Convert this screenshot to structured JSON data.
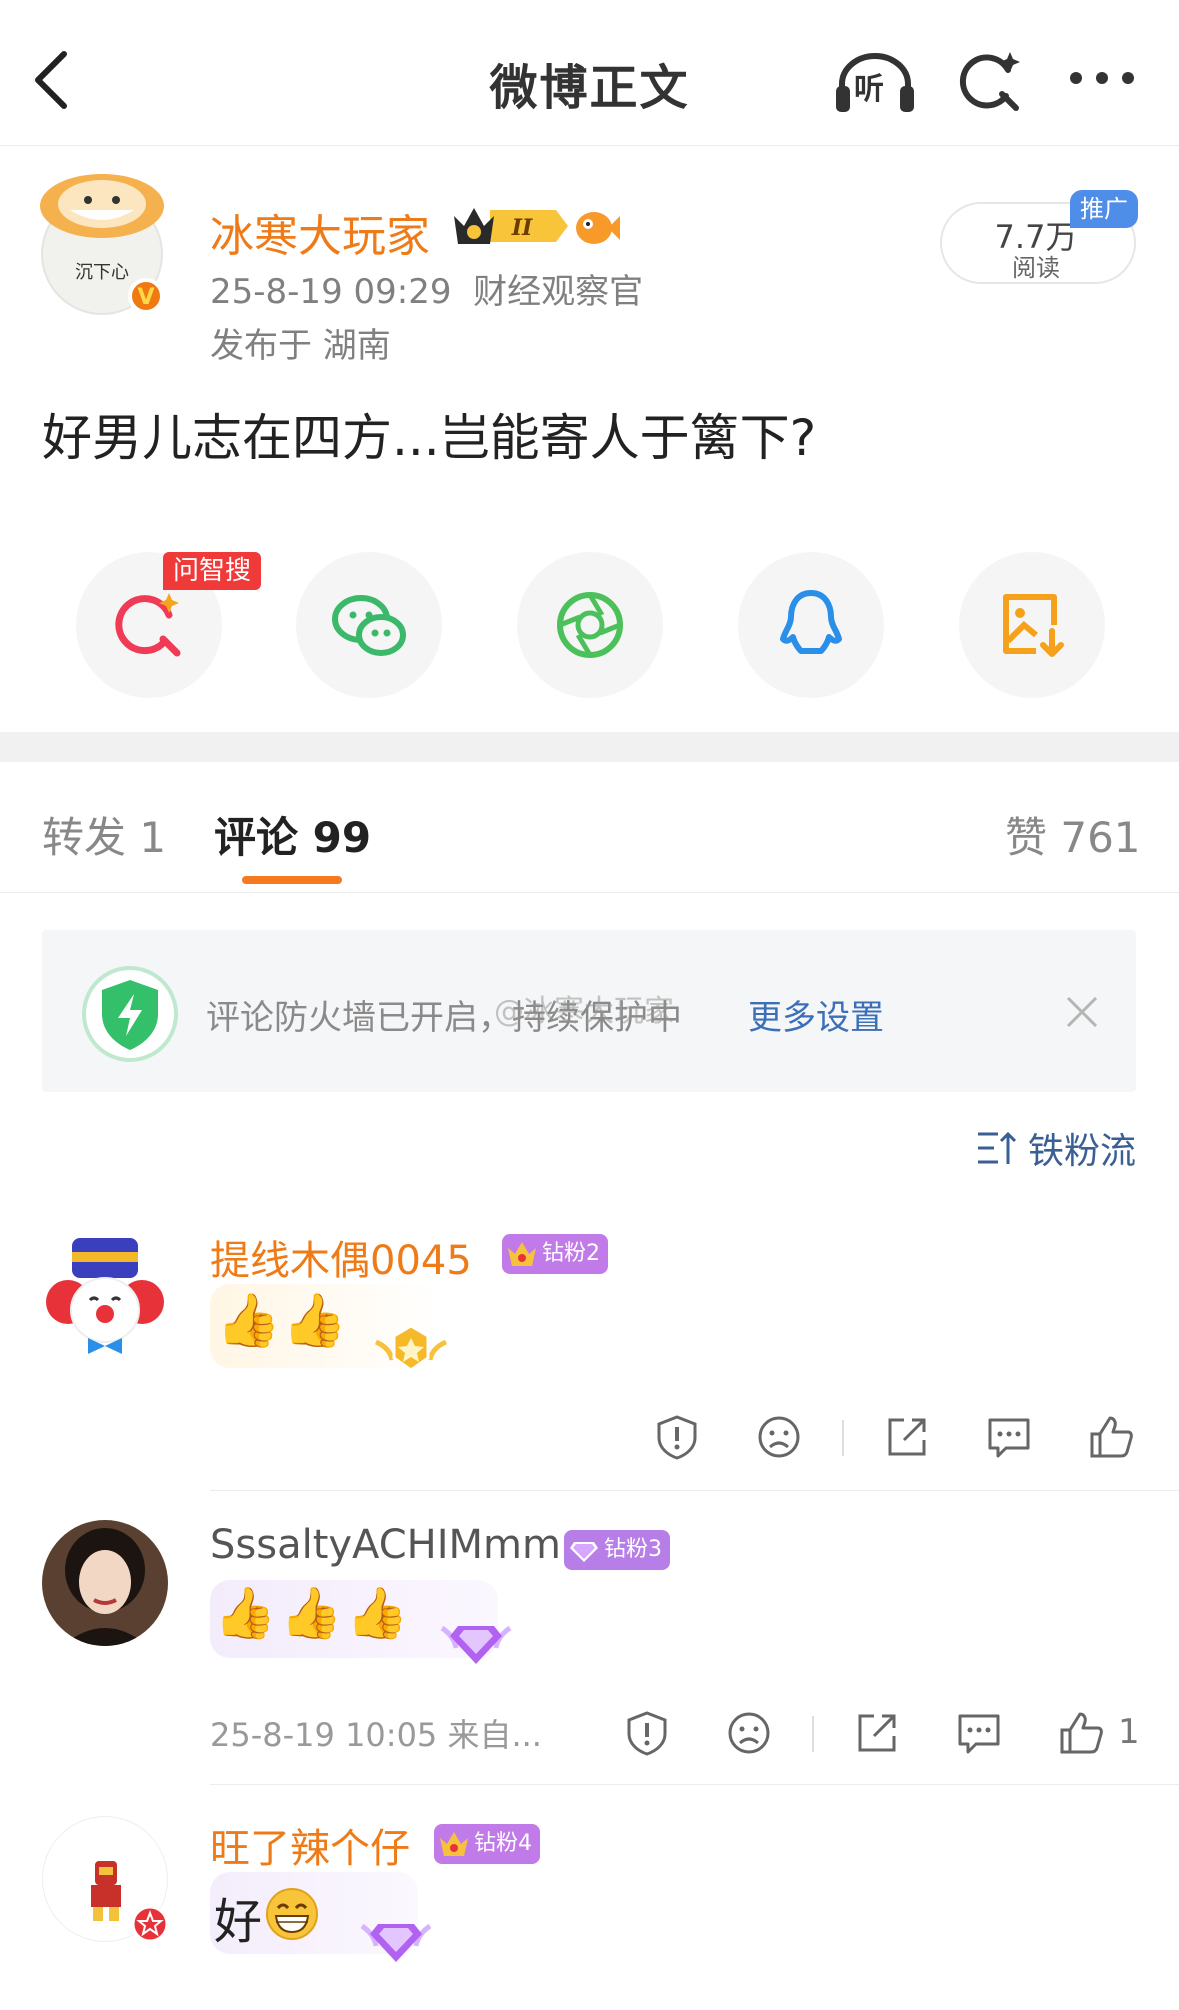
{
  "header": {
    "title": "微博正文",
    "listen_label": "听"
  },
  "author": {
    "name": "冰寒大玩家",
    "avatar_text": "沉下心",
    "level_badge": "II",
    "meta": "25-8-19 09:29  财经观察官",
    "location": "发布于 湖南"
  },
  "reads": {
    "count": "7.7万",
    "label": "阅读",
    "promo": "推广"
  },
  "post": {
    "text": "好男儿志在四方...岂能寄人于篱下?"
  },
  "share": {
    "ai_search_tag": "问智搜",
    "items": [
      "ai-search",
      "wechat",
      "moments",
      "qq",
      "save-image"
    ]
  },
  "tabs": {
    "repost": "转发 1",
    "comments": "评论 99",
    "likes": "赞 761"
  },
  "firewall": {
    "text": "评论防火墙已开启，持续保护中",
    "link": "更多设置",
    "watermark": "@冰寒大玩家"
  },
  "sort": {
    "label": "铁粉流"
  },
  "comments": [
    {
      "user": "提线木偶0045",
      "badge": "钻粉2",
      "text": "",
      "time": "",
      "likes": ""
    },
    {
      "user": "SssaltyACHIMmm",
      "badge": "钻粉3",
      "text": "",
      "time": "25-8-19 10:05  来自...",
      "likes": "1"
    },
    {
      "user": "旺了辣个仔",
      "badge": "钻粉4",
      "text": "好",
      "time": "",
      "likes": ""
    }
  ],
  "colors": {
    "accent": "#ef7b18",
    "link": "#3b6fb8",
    "badge_purple": "#b77ee8",
    "promo_blue": "#4f8ee8"
  }
}
